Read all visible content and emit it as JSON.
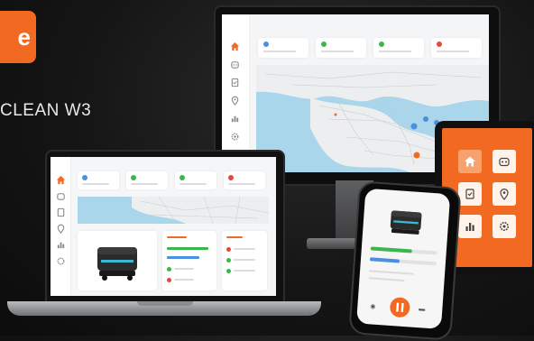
{
  "hero": {
    "badge_letter": "e",
    "product_name": "CLEAN W3"
  },
  "colors": {
    "accent": "#f26a21",
    "blue": "#4a90e2",
    "green": "#3cb54a",
    "red": "#e5483b",
    "map_water": "#a9d6ea"
  },
  "monitor": {
    "nav_icons": [
      "home-icon",
      "robot-icon",
      "task-icon",
      "location-icon",
      "analytics-icon",
      "settings-icon"
    ],
    "stat_cards": [
      {
        "status_color": "blue"
      },
      {
        "status_color": "green"
      },
      {
        "status_color": "green"
      },
      {
        "status_color": "red"
      }
    ]
  },
  "tablet": {
    "tiles": [
      "home-icon",
      "robot-icon",
      "task-icon",
      "location-icon",
      "analytics-icon",
      "settings-icon"
    ]
  },
  "laptop": {
    "nav_icons": [
      "home-icon",
      "robot-icon",
      "task-icon",
      "location-icon",
      "analytics-icon",
      "settings-icon"
    ]
  },
  "phone": {
    "progress": [
      0.62,
      0.45
    ]
  }
}
